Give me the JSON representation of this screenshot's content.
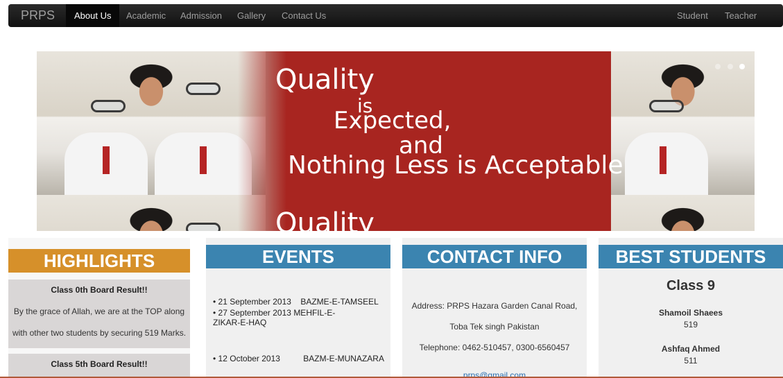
{
  "navbar": {
    "brand": "PRPS",
    "left_items": [
      "About Us",
      "Academic",
      "Admission",
      "Gallery",
      "Contact Us"
    ],
    "active_item": "About Us",
    "right_items": [
      "Student",
      "Teacher"
    ]
  },
  "carousel": {
    "lines": [
      "Quality",
      "is",
      "Expected,",
      "and",
      "Nothing Less is Acceptable"
    ],
    "next_slide_line": "Quality",
    "indicator_count": 3,
    "active_indicator": 3
  },
  "highlights": {
    "title": "HIGHLIGHTS",
    "items": [
      {
        "heading": "Class 0th Board Result!!",
        "body_lines": [
          "By the grace of Allah, we are at the TOP along",
          "with other two students by securing 519 Marks."
        ]
      },
      {
        "heading": "Class 5th Board Result!!",
        "body_lines": []
      }
    ]
  },
  "events": {
    "title": "EVENTS",
    "items": [
      {
        "date": "21 September 2013",
        "name": "BAZME-E-TAMSEEL"
      },
      {
        "date": "27 September 2013",
        "name": "MEHFIL-E-ZIKAR-E-HAQ"
      },
      {
        "date": "12 October 2013",
        "name": "BAZM-E-MUNAZARA"
      }
    ]
  },
  "contact": {
    "title": "CONTACT INFO",
    "address_line1": "Address: PRPS Hazara Garden Canal Road,",
    "address_line2": "Toba Tek singh Pakistan",
    "telephone": "Telephone: 0462-510457, 0300-6560457",
    "email": "prps@gmail.com"
  },
  "best_students": {
    "title": "BEST STUDENTS",
    "class_label": "Class 9",
    "students": [
      {
        "name": "Shamoil Shaees",
        "score": "519"
      },
      {
        "name": "Ashfaq Ahmed",
        "score": "511"
      }
    ]
  },
  "colors": {
    "navbar": "#111111",
    "highlights_title": "#d6902a",
    "panel_title_blue": "#3b84b0",
    "banner_red": "#a82520",
    "link": "#2a6fb0"
  }
}
